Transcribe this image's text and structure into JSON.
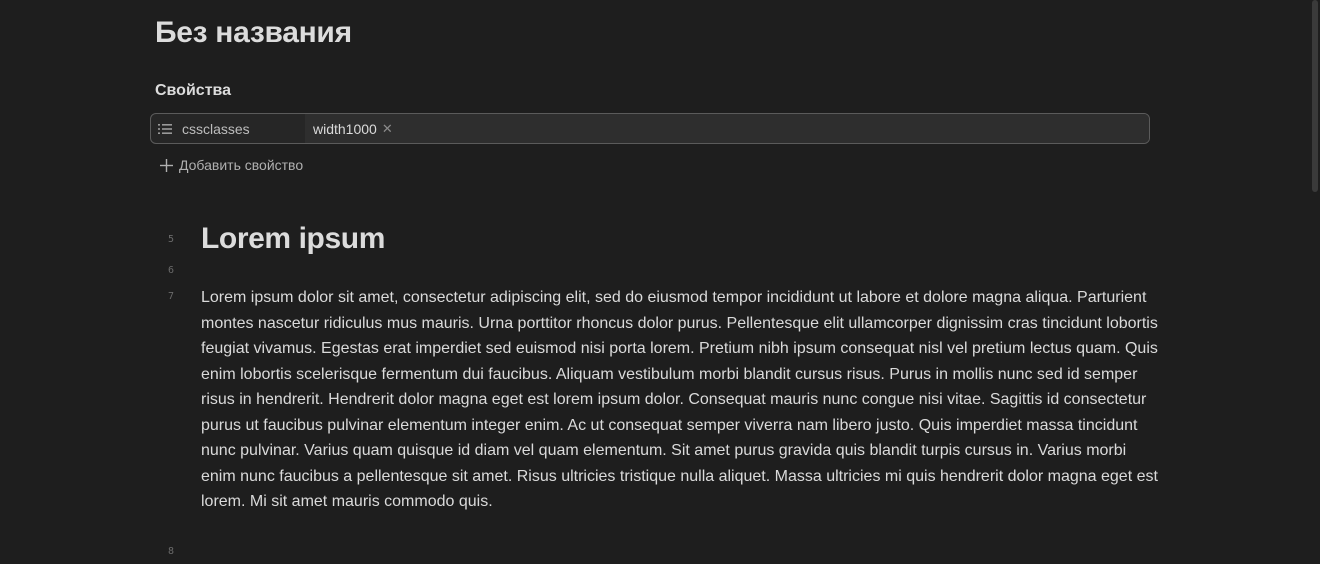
{
  "note": {
    "title": "Без названия"
  },
  "properties": {
    "heading": "Свойства",
    "items": [
      {
        "key": "cssclasses",
        "key_icon": "list-icon",
        "values": [
          "width1000"
        ]
      }
    ],
    "add_label": "Добавить свойство"
  },
  "editor": {
    "line_numbers": [
      "5",
      "6",
      "7",
      "8"
    ],
    "heading": "Lorem ipsum",
    "paragraph": "Lorem ipsum dolor sit amet, consectetur adipiscing elit, sed do eiusmod tempor incididunt ut labore et dolore magna aliqua. Parturient montes nascetur ridiculus mus mauris. Urna porttitor rhoncus dolor purus. Pellentesque elit ullamcorper dignissim cras tincidunt lobortis feugiat vivamus. Egestas erat imperdiet sed euismod nisi porta lorem. Pretium nibh ipsum consequat nisl vel pretium lectus quam. Quis enim lobortis scelerisque fermentum dui faucibus. Aliquam vestibulum morbi blandit cursus risus. Purus in mollis nunc sed id semper risus in hendrerit. Hendrerit dolor magna eget est lorem ipsum dolor. Consequat mauris nunc congue nisi vitae. Sagittis id consectetur purus ut faucibus pulvinar elementum integer enim. Ac ut consequat semper viverra nam libero justo. Quis imperdiet massa tincidunt nunc pulvinar. Varius quam quisque id diam vel quam elementum. Sit amet purus gravida quis blandit turpis cursus in. Varius morbi enim nunc faucibus a pellentesque sit amet. Risus ultricies tristique nulla aliquet. Massa ultricies mi quis hendrerit dolor magna eget est lorem. Mi sit amet mauris commodo quis."
  },
  "colors": {
    "background": "#1e1e1e",
    "text": "#dadada",
    "muted_text": "#b0b0b0",
    "line_number": "#6a6a6a",
    "property_border": "#5b5b5b",
    "property_value_bg": "#2e2e2e"
  }
}
